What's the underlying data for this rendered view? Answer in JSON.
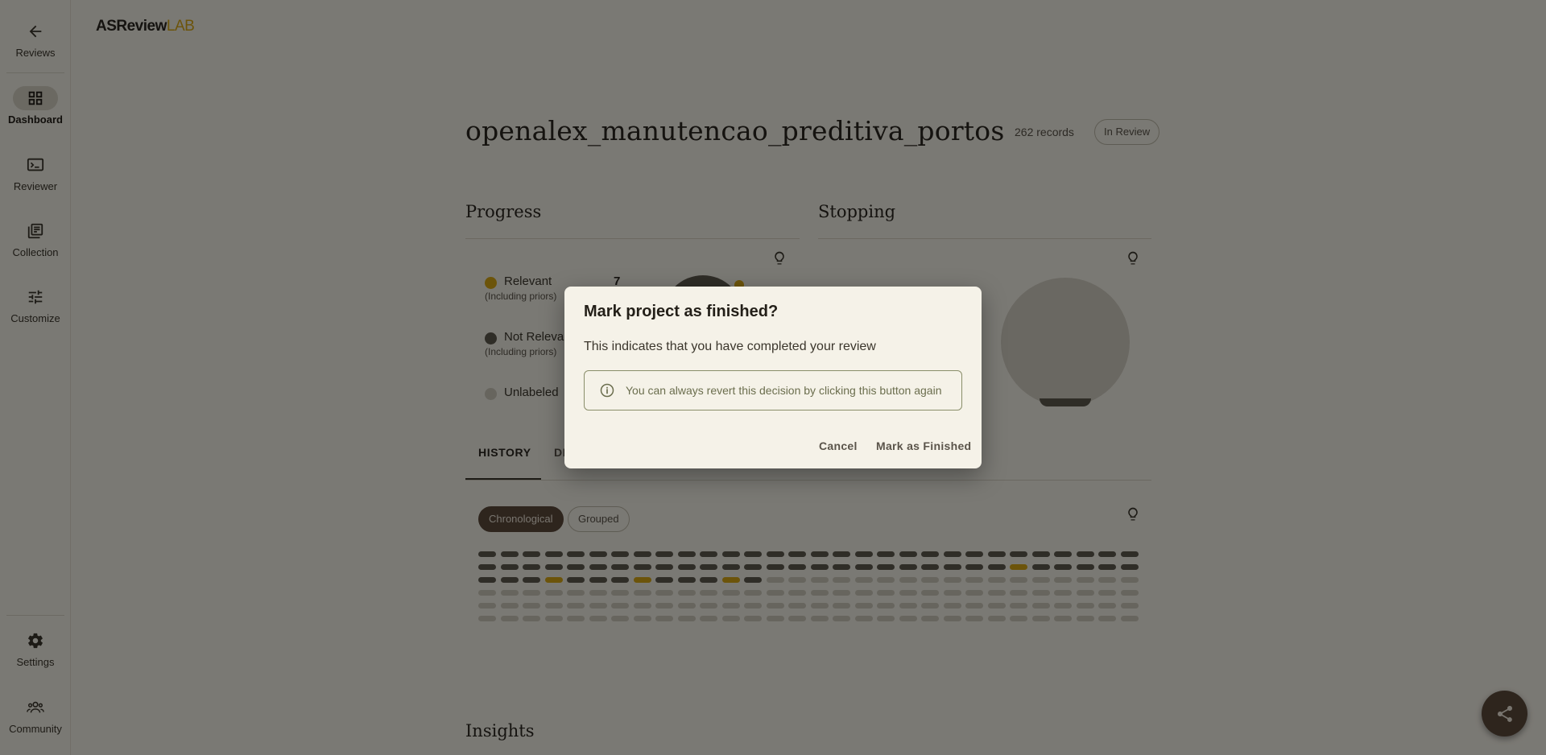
{
  "app": {
    "logo_part1": "ASReview",
    "logo_part2": "LAB"
  },
  "sidebar": {
    "items": [
      {
        "label": "Reviews",
        "icon": "arrow-back-icon"
      },
      {
        "label": "Dashboard",
        "icon": "dashboard-icon",
        "active": true
      },
      {
        "label": "Reviewer",
        "icon": "reviewer-icon"
      },
      {
        "label": "Collection",
        "icon": "collection-icon"
      },
      {
        "label": "Customize",
        "icon": "tune-icon"
      }
    ],
    "bottom_items": [
      {
        "label": "Settings",
        "icon": "gear-icon"
      },
      {
        "label": "Community",
        "icon": "community-icon"
      }
    ]
  },
  "project": {
    "title": "openalex_manutencao_preditiva_portos",
    "records": "262 records",
    "status": "In Review"
  },
  "progress": {
    "title": "Progress",
    "legend": [
      {
        "label": "Relevant",
        "sub": "(Including priors)",
        "count": "7",
        "color": "#d9a915"
      },
      {
        "label": "Not Relevant",
        "sub": "(Including priors)",
        "count": "",
        "color": "#5f5a4f"
      },
      {
        "label": "Unlabeled",
        "sub": "",
        "count": "",
        "color": "#cfcbbd"
      }
    ]
  },
  "stopping": {
    "title": "Stopping"
  },
  "tabs": {
    "history": "HISTORY",
    "density": "DE"
  },
  "chips": {
    "chronological": "Chronological",
    "grouped": "Grouped"
  },
  "history_grid": {
    "columns": 30,
    "total": 180,
    "labeled": 73,
    "relevant_indices": [
      54,
      63,
      67,
      71,
      74,
      79,
      80,
      84
    ]
  },
  "insights": {
    "title": "Insights"
  },
  "dialog": {
    "title": "Mark project as finished?",
    "text": "This indicates that you have completed your review",
    "info": "You can always revert this decision by clicking this button again",
    "cancel": "Cancel",
    "confirm": "Mark as Finished"
  },
  "colors": {
    "relevant": "#d9a915",
    "irrelevant": "#5f5a4f",
    "unlabeled": "#cfcbbd",
    "accent_dark": "#5c4a3b"
  }
}
